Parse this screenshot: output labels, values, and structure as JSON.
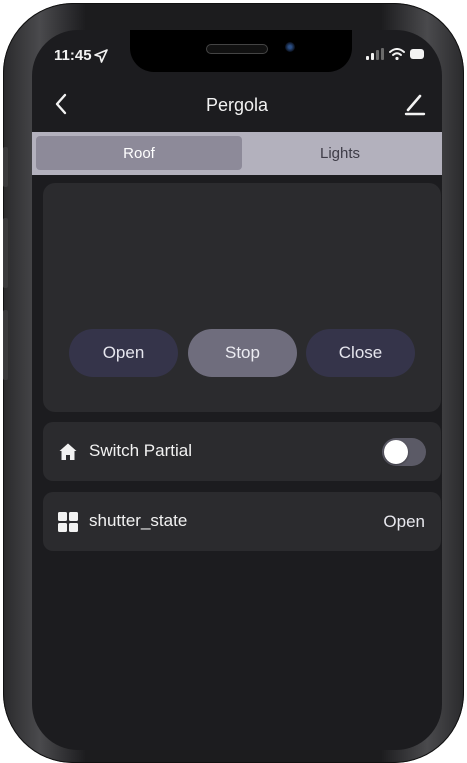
{
  "status_bar": {
    "time": "11:45"
  },
  "nav": {
    "title": "Pergola"
  },
  "tabs": [
    {
      "label": "Roof",
      "active": true
    },
    {
      "label": "Lights",
      "active": false
    }
  ],
  "roof_controls": {
    "open_label": "Open",
    "stop_label": "Stop",
    "close_label": "Close"
  },
  "switch_partial": {
    "label": "Switch Partial",
    "on": false
  },
  "shutter_state": {
    "label": "shutter_state",
    "value": "Open"
  },
  "colors": {
    "background": "#1c1c1f",
    "card": "#2b2b2e",
    "tab_bar": "#b3b1bd",
    "tab_active": "#8d8a99",
    "button": "#35344a",
    "button_active": "#6f6d7d"
  }
}
